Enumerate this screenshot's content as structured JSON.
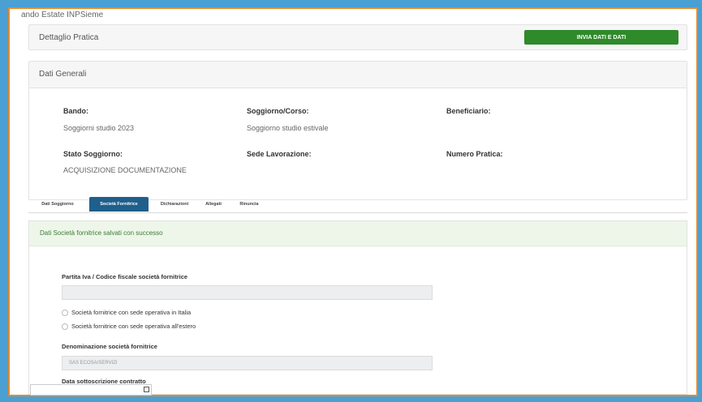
{
  "breadcrumb": "ando Estate INPSieme",
  "detail": {
    "title": "Dettaglio Pratica",
    "action_button": "INVIA DATI E DATI"
  },
  "general": {
    "heading": "Dati Generali",
    "fields": [
      {
        "label": "Bando:",
        "value": "Soggiorni studio 2023"
      },
      {
        "label": "Soggiorno/Corso:",
        "value": "Soggiorno studio estivale"
      },
      {
        "label": "Beneficiario:",
        "value": ""
      },
      {
        "label": "Stato Soggiorno:",
        "value": "ACQUISIZIONE DOCUMENTAZIONE"
      },
      {
        "label": "Sede Lavorazione:",
        "value": ""
      },
      {
        "label": "Numero Pratica:",
        "value": ""
      }
    ]
  },
  "tabs": [
    {
      "label": "Dati Soggiorno",
      "active": false
    },
    {
      "label": "Società Fornitrice",
      "active": true
    },
    {
      "label": "Dichiarazioni",
      "active": false
    },
    {
      "label": "Allegati",
      "active": false
    },
    {
      "label": "Rinuncia",
      "active": false
    }
  ],
  "form": {
    "success_message": "Dati Società fornitrice salvati con successo",
    "piva_label": "Partita Iva / Codice fiscale società fornitrice",
    "piva_value": "",
    "radio_italy": "Società fornitrice con sede operativa in Italia",
    "radio_abroad": "Società fornitrice con sede operativa all'estero",
    "name_label": "Denominazione società fornitrice",
    "name_value": "SAS ECOSA/SERVIZI",
    "date_label": "Data sottoscrizione contratto"
  }
}
